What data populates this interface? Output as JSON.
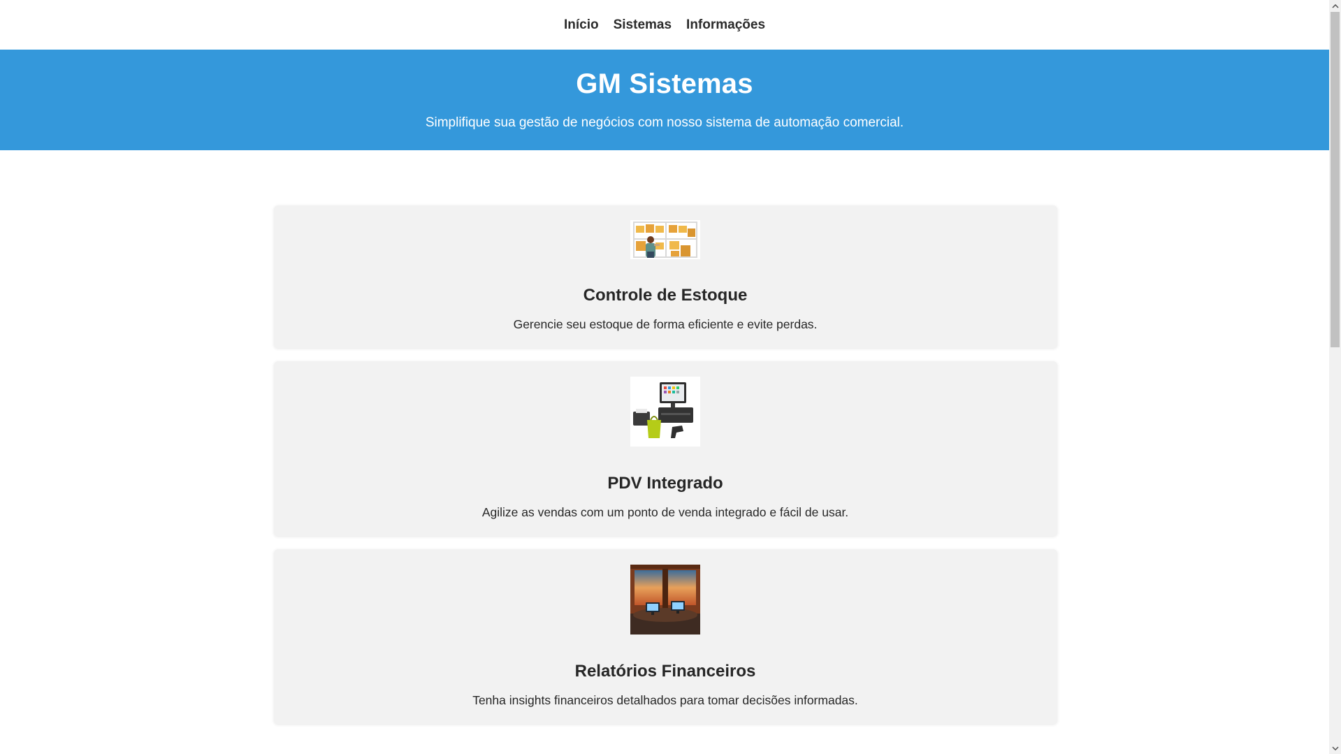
{
  "nav": {
    "items": [
      {
        "label": "Início"
      },
      {
        "label": "Sistemas"
      },
      {
        "label": "Informações"
      }
    ]
  },
  "hero": {
    "title": "GM Sistemas",
    "subtitle": "Simplifique sua gestão de negócios com nosso sistema de automação comercial."
  },
  "cards": [
    {
      "title": "Controle de Estoque",
      "description": "Gerencie seu estoque de forma eficiente e evite perdas."
    },
    {
      "title": "PDV Integrado",
      "description": "Agilize as vendas com um ponto de venda integrado e fácil de usar."
    },
    {
      "title": "Relatórios Financeiros",
      "description": "Tenha insights financeiros detalhados para tomar decisões informadas."
    }
  ],
  "colors": {
    "hero_background": "#3498db",
    "card_background": "#f2f2f2",
    "text": "#262626"
  }
}
